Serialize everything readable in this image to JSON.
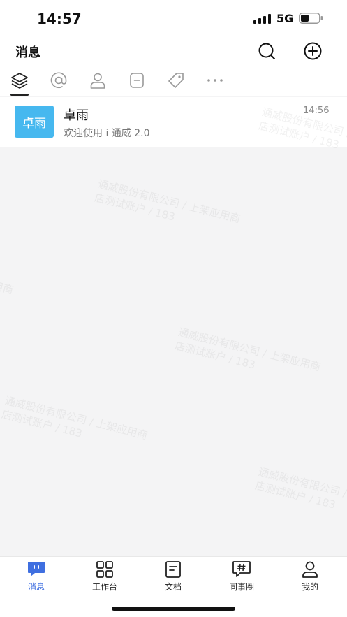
{
  "status_bar": {
    "time": "14:57",
    "network": "5G"
  },
  "header": {
    "title": "消息"
  },
  "filter_tabs": [
    {
      "icon": "layers-icon",
      "active": true
    },
    {
      "icon": "at-icon"
    },
    {
      "icon": "contact-icon"
    },
    {
      "icon": "bookmark-icon"
    },
    {
      "icon": "tag-icon"
    },
    {
      "icon": "more-icon"
    }
  ],
  "messages": [
    {
      "avatar_text": "卓雨",
      "name": "卓雨",
      "preview": "欢迎使用 i 通威 2.0",
      "time": "14:56"
    }
  ],
  "watermark_text": "通威股份有限公司 / 上架应用商\n店测试账户 / 183",
  "tab_bar": {
    "items": [
      {
        "label": "消息",
        "icon": "chat-icon",
        "active": true
      },
      {
        "label": "工作台",
        "icon": "grid-icon"
      },
      {
        "label": "文档",
        "icon": "document-icon"
      },
      {
        "label": "同事圈",
        "icon": "hashtag-chat-icon"
      },
      {
        "label": "我的",
        "icon": "user-icon"
      }
    ]
  },
  "colors": {
    "accent": "#3f6fe0",
    "avatar_bg": "#46b8ef",
    "background": "#f4f4f5"
  }
}
